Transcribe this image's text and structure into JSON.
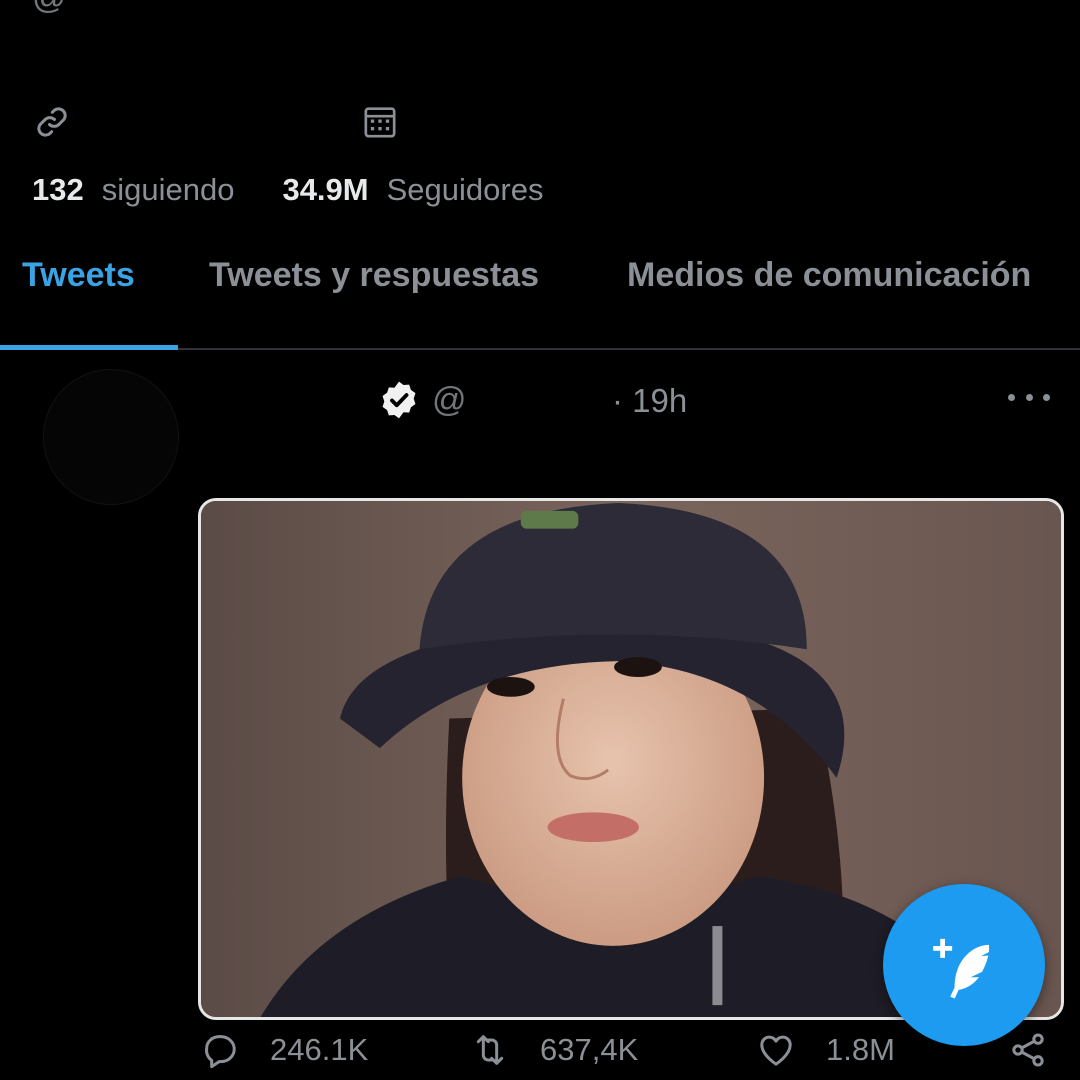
{
  "profile": {
    "handle_prefix": "@",
    "icons": {
      "website": "link-icon",
      "joined": "calendar-icon"
    },
    "following_count": "132",
    "following_label": "siguiendo",
    "followers_count": "34.9M",
    "followers_label": "Seguidores"
  },
  "tabs": [
    {
      "label": "Tweets",
      "active": true
    },
    {
      "label": "Tweets y respuestas",
      "active": false
    },
    {
      "label": "Medios de comunicación",
      "active": false
    }
  ],
  "tweet": {
    "handle_prefix": "@",
    "time": "· 19h",
    "verified_icon": "verified-badge-icon",
    "more_icon": "more-options-icon",
    "actions": {
      "replies": "246.1K",
      "retweets": "637,4K",
      "likes": "1.8M",
      "share_icon": "share-icon"
    }
  },
  "compose_button": {
    "icon": "compose-tweet-icon"
  },
  "colors": {
    "background": "#000000",
    "accent": "#1d9bf0",
    "tab_active": "#3aa3e3",
    "muted": "#8b9096",
    "text": "#e7e9ea"
  }
}
